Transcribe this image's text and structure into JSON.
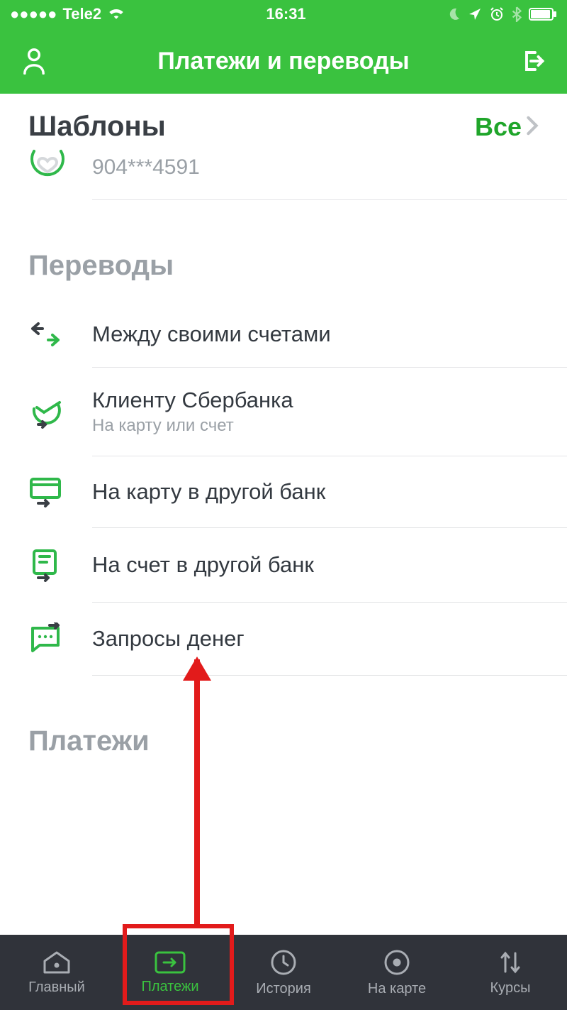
{
  "status": {
    "carrier": "Tele2",
    "time": "16:31"
  },
  "header": {
    "title": "Платежи и переводы"
  },
  "templates": {
    "title": "Шаблоны",
    "all": "Все",
    "item": "904***4591"
  },
  "transfers": {
    "title": "Переводы",
    "items": [
      {
        "title": "Между своими счетами",
        "sub": ""
      },
      {
        "title": "Клиенту Сбербанка",
        "sub": "На карту или счет"
      },
      {
        "title": "На карту в другой банк",
        "sub": ""
      },
      {
        "title": "На счет в другой банк",
        "sub": ""
      },
      {
        "title": "Запросы денег",
        "sub": ""
      }
    ]
  },
  "payments": {
    "title": "Платежи"
  },
  "tabs": [
    {
      "label": "Главный"
    },
    {
      "label": "Платежи"
    },
    {
      "label": "История"
    },
    {
      "label": "На карте"
    },
    {
      "label": "Курсы"
    }
  ]
}
